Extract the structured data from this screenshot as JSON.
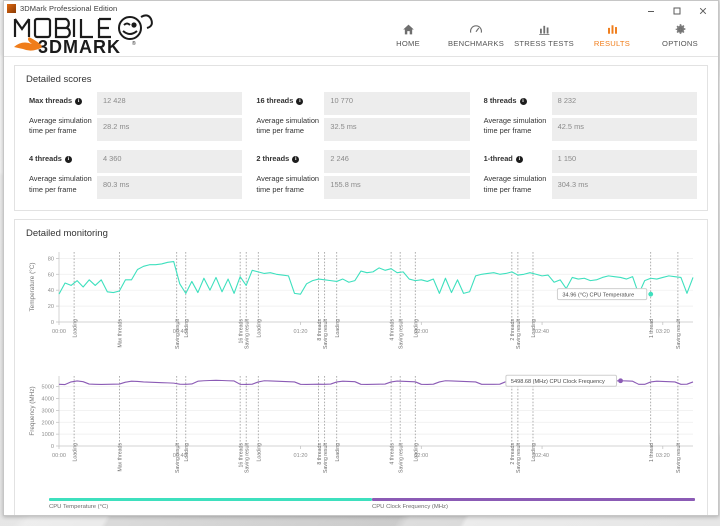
{
  "window": {
    "title": "3DMark Professional Edition",
    "minimize_label": "Minimize",
    "maximize_label": "Maximize",
    "close_label": "Close"
  },
  "brand": {
    "line1": "MOBILE",
    "line2": "3DMARK"
  },
  "nav": {
    "items": [
      {
        "label": "HOME",
        "icon": "home-icon",
        "active": false
      },
      {
        "label": "BENCHMARKS",
        "icon": "speedometer-icon",
        "active": false
      },
      {
        "label": "STRESS TESTS",
        "icon": "bar-chart-icon",
        "active": false
      },
      {
        "label": "RESULTS",
        "icon": "bar-chart-icon",
        "active": true
      },
      {
        "label": "OPTIONS",
        "icon": "gear-icon",
        "active": false
      }
    ]
  },
  "scores": {
    "title": "Detailed scores",
    "sub_label": "Average simulation time per frame",
    "cells": [
      {
        "name": "Max threads",
        "score": "12 428",
        "avg": "28.2 ms"
      },
      {
        "name": "16 threads",
        "score": "10 770",
        "avg": "32.5 ms"
      },
      {
        "name": "8 threads",
        "score": "8 232",
        "avg": "42.5 ms"
      },
      {
        "name": "4 threads",
        "score": "4 360",
        "avg": "80.3 ms"
      },
      {
        "name": "2 threads",
        "score": "2 246",
        "avg": "155.8 ms"
      },
      {
        "name": "1-thread",
        "score": "1 150",
        "avg": "304.3 ms"
      }
    ]
  },
  "monitoring": {
    "title": "Detailed monitoring",
    "legend": [
      {
        "label": "CPU Temperature (°C)",
        "color": "#3ee0be"
      },
      {
        "label": "CPU Clock Frequency (MHz)",
        "color": "#8b5bb5"
      }
    ],
    "tooltips": {
      "temperature": "34.96 (°C) CPU Temperature",
      "frequency": "5498.68 (MHz) CPU Clock Frequency"
    },
    "events": [
      "Loading",
      "Max threads",
      "Saving result",
      "Loading",
      "16 threads",
      "Saving result",
      "Loading",
      "8 threads",
      "Saving result",
      "Loading",
      "4 threads",
      "Saving result",
      "Loading",
      "2 threads",
      "Saving result",
      "Loading",
      "1 thread",
      "Saving result"
    ]
  },
  "chart_data": [
    {
      "type": "line",
      "title": "CPU Temperature",
      "ylabel": "Temperature (°C)",
      "xlabel": "",
      "ylim": [
        0,
        88
      ],
      "yticks": [
        0,
        20,
        40,
        60,
        80
      ],
      "xlim": [
        0,
        210
      ],
      "xticks": [
        0,
        40,
        80,
        120,
        160,
        200
      ],
      "xticklabels": [
        "00:00",
        "00:40",
        "01:20",
        "02:00",
        "02:40",
        "03:20"
      ],
      "grid": true,
      "units": "°C",
      "series": [
        {
          "name": "CPU Temperature (°C)",
          "color": "#3ee0be",
          "x": [
            0,
            2,
            4,
            6,
            8,
            10,
            12,
            14,
            16,
            18,
            20,
            22,
            24,
            26,
            28,
            30,
            32,
            34,
            36,
            38,
            40,
            42,
            44,
            46,
            48,
            50,
            52,
            54,
            56,
            58,
            60,
            62,
            64,
            66,
            68,
            70,
            72,
            74,
            76,
            78,
            80,
            82,
            84,
            86,
            88,
            90,
            92,
            94,
            96,
            98,
            100,
            102,
            104,
            106,
            108,
            110,
            112,
            114,
            116,
            118,
            120,
            122,
            124,
            126,
            128,
            130,
            132,
            134,
            136,
            138,
            140,
            142,
            144,
            146,
            148,
            150,
            152,
            154,
            156,
            158,
            160,
            162,
            164,
            166,
            168,
            170,
            172,
            174,
            176,
            178,
            180,
            182,
            184,
            186,
            188,
            190,
            192,
            194,
            196,
            198,
            200,
            202,
            204,
            206,
            208,
            210
          ],
          "y": [
            35,
            49,
            46,
            52,
            44,
            53,
            46,
            53,
            38,
            37,
            39,
            53,
            53,
            66,
            70,
            72,
            72,
            73,
            75,
            76,
            48,
            36,
            51,
            37,
            55,
            40,
            56,
            38,
            54,
            36,
            57,
            46,
            65,
            63,
            61,
            62,
            60,
            59,
            58,
            36,
            35,
            48,
            52,
            54,
            53,
            52,
            51,
            54,
            50,
            52,
            64,
            62,
            63,
            68,
            65,
            67,
            62,
            63,
            54,
            52,
            53,
            51,
            54,
            36,
            55,
            37,
            53,
            36,
            38,
            58,
            60,
            61,
            62,
            60,
            61,
            63,
            59,
            60,
            62,
            60,
            58,
            59,
            50,
            53,
            42,
            56,
            54,
            55,
            52,
            53,
            56,
            58,
            57,
            56,
            54,
            57,
            35,
            52,
            55,
            54,
            56,
            58,
            57,
            56,
            36,
            56
          ]
        }
      ],
      "annotation": {
        "text": "34.96 (°C) CPU Temperature",
        "x": 196,
        "y": 35
      }
    },
    {
      "type": "line",
      "title": "CPU Clock Frequency",
      "ylabel": "Frequency (MHz)",
      "xlabel": "",
      "ylim": [
        0,
        5900
      ],
      "yticks": [
        0,
        1000,
        2000,
        3000,
        4000,
        5000
      ],
      "xlim": [
        0,
        210
      ],
      "xticks": [
        0,
        40,
        80,
        120,
        160,
        200
      ],
      "xticklabels": [
        "00:00",
        "00:40",
        "01:20",
        "02:00",
        "02:40",
        "03:20"
      ],
      "grid": true,
      "units": "MHz",
      "series": [
        {
          "name": "CPU Clock Frequency (MHz)",
          "color": "#8b5bb5",
          "x": [
            0,
            2,
            4,
            6,
            8,
            10,
            12,
            14,
            16,
            18,
            20,
            22,
            24,
            26,
            28,
            30,
            32,
            34,
            36,
            38,
            40,
            42,
            44,
            46,
            48,
            50,
            52,
            54,
            56,
            58,
            60,
            62,
            64,
            66,
            68,
            70,
            72,
            74,
            76,
            78,
            80,
            82,
            84,
            86,
            88,
            90,
            92,
            94,
            96,
            98,
            100,
            102,
            104,
            106,
            108,
            110,
            112,
            114,
            116,
            118,
            120,
            122,
            124,
            126,
            128,
            130,
            132,
            134,
            136,
            138,
            140,
            142,
            144,
            146,
            148,
            150,
            152,
            154,
            156,
            158,
            160,
            162,
            164,
            166,
            168,
            170,
            172,
            174,
            176,
            178,
            180,
            182,
            184,
            186,
            188,
            190,
            192,
            194,
            196,
            198,
            200,
            202,
            204,
            206,
            208,
            210
          ],
          "y": [
            5200,
            5180,
            5400,
            5480,
            5420,
            5220,
            5200,
            5190,
            5200,
            5210,
            5220,
            5380,
            5460,
            5440,
            5400,
            5380,
            5360,
            5340,
            5320,
            5300,
            5210,
            5200,
            5230,
            5460,
            5500,
            5520,
            5540,
            5520,
            5500,
            5480,
            5200,
            5190,
            5210,
            5400,
            5500,
            5480,
            5460,
            5440,
            5420,
            5400,
            5200,
            5190,
            5200,
            5210,
            5200,
            5220,
            5400,
            5460,
            5440,
            5420,
            5200,
            5190,
            5200,
            5210,
            5220,
            5400,
            5470,
            5450,
            5430,
            5410,
            5200,
            5190,
            5210,
            5400,
            5500,
            5480,
            5460,
            5440,
            5420,
            5400,
            5200,
            5195,
            5200,
            5210,
            5420,
            5500,
            5480,
            5460,
            5440,
            5420,
            5200,
            5190,
            5200,
            5400,
            5480,
            5460,
            5440,
            5420,
            5400,
            5380,
            5200,
            5220,
            5480,
            5499,
            5480,
            5460,
            5200,
            5195,
            5400,
            5460,
            5440,
            5420,
            5400,
            5200,
            5210,
            5400
          ]
        }
      ],
      "annotation": {
        "text": "5498.68 (MHz) CPU Clock Frequency",
        "x": 186,
        "y": 5499
      }
    }
  ]
}
